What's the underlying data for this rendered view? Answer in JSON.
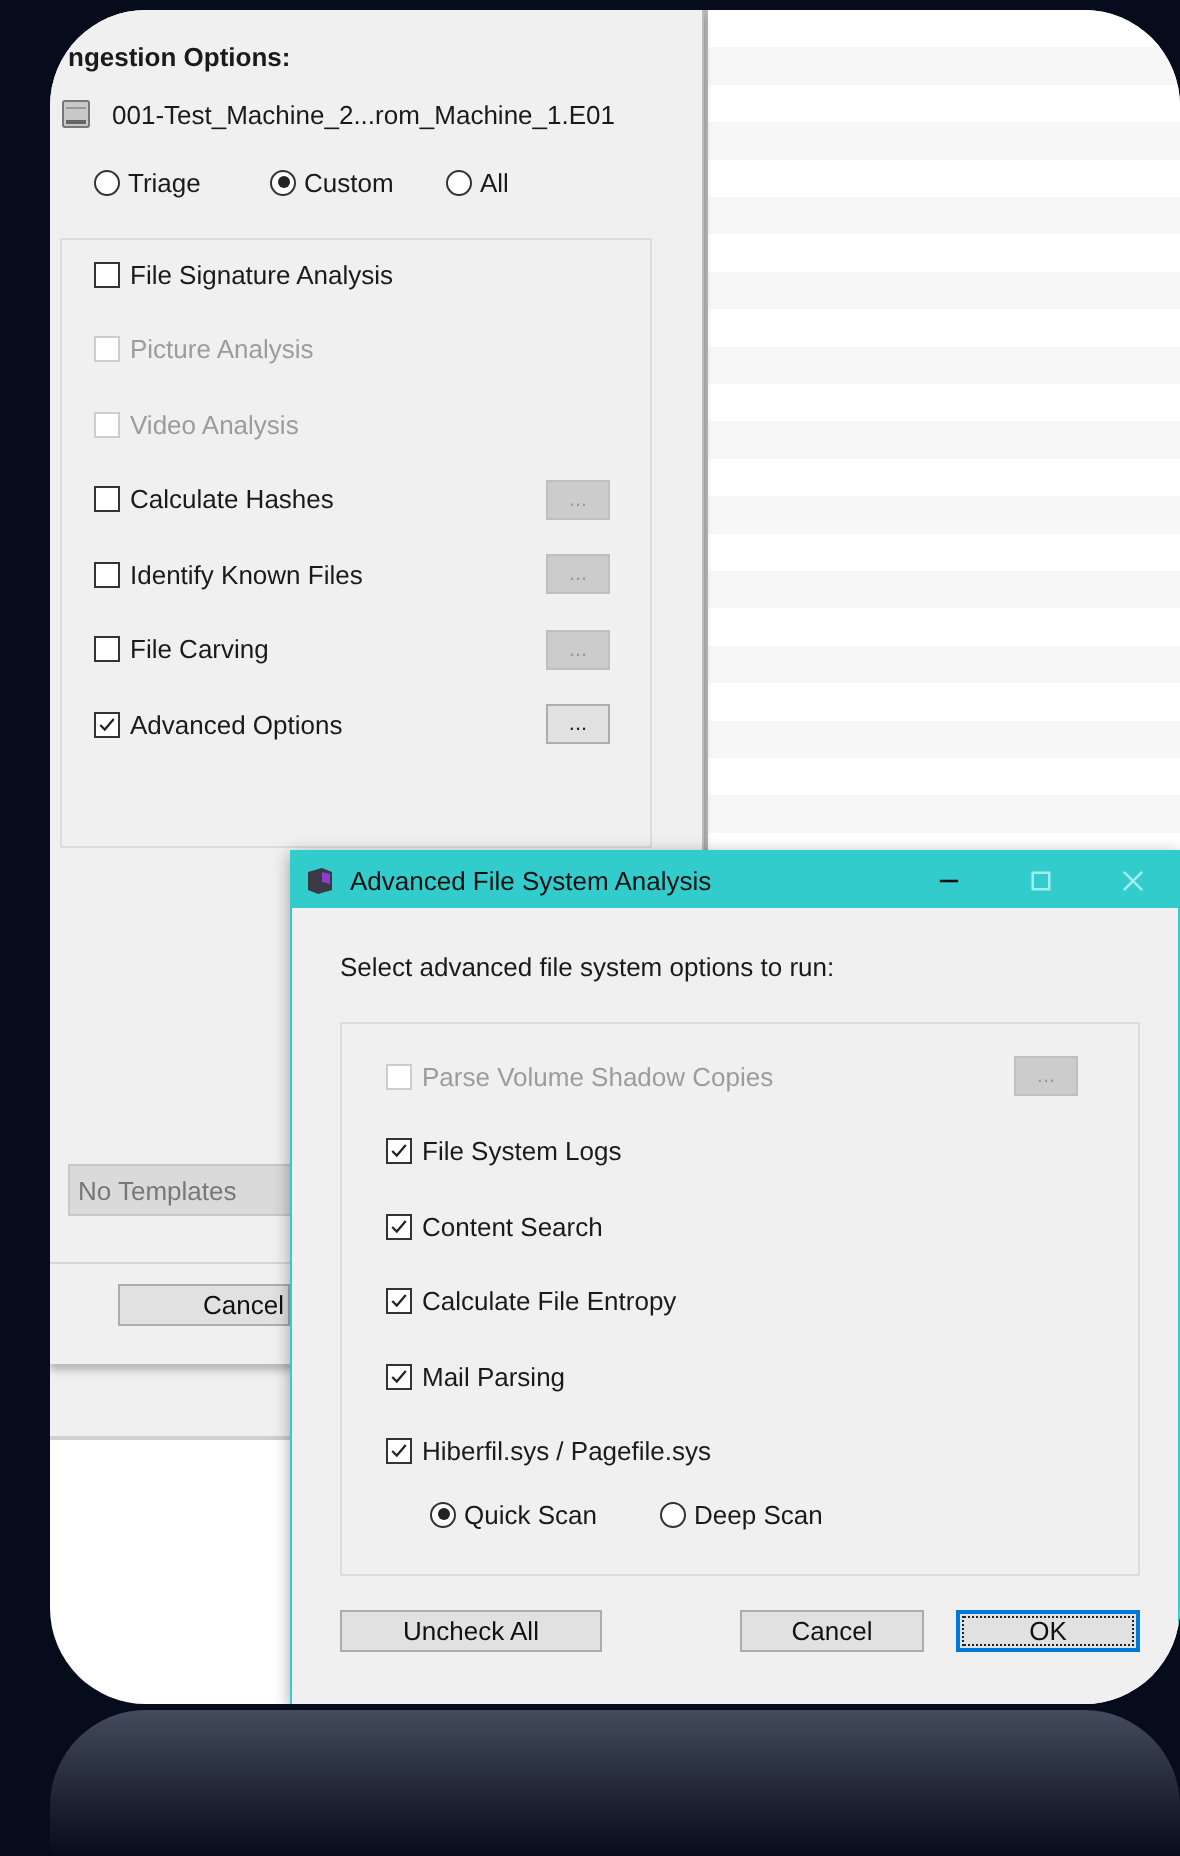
{
  "ingestion_dialog": {
    "title": "ngestion Options:",
    "source": "001-Test_Machine_2...rom_Machine_1.E01",
    "modes": [
      {
        "label": "Triage",
        "selected": false
      },
      {
        "label": "Custom",
        "selected": true
      },
      {
        "label": "All",
        "selected": false
      }
    ],
    "options": [
      {
        "label": "File Signature Analysis",
        "checked": false,
        "disabled": false
      },
      {
        "label": "Picture Analysis",
        "checked": false,
        "disabled": true
      },
      {
        "label": "Video Analysis",
        "checked": false,
        "disabled": true
      },
      {
        "label": "Calculate Hashes",
        "checked": false,
        "disabled": false,
        "settings": {
          "label": "...",
          "disabled": true
        }
      },
      {
        "label": "Identify Known Files",
        "checked": false,
        "disabled": false,
        "settings": {
          "label": "...",
          "disabled": true
        }
      },
      {
        "label": "File Carving",
        "checked": false,
        "disabled": false,
        "settings": {
          "label": "...",
          "disabled": true
        }
      },
      {
        "label": "Advanced Options",
        "checked": true,
        "disabled": false,
        "settings": {
          "label": "...",
          "disabled": false
        }
      }
    ],
    "template_field": {
      "value": "No Templates"
    },
    "cancel_button": "Cancel"
  },
  "advanced_dialog": {
    "title": "Advanced File System Analysis",
    "title_buttons": [
      {
        "kind": "minimize",
        "disabled": false
      },
      {
        "kind": "maximize",
        "disabled": true
      },
      {
        "kind": "close",
        "disabled": true
      }
    ],
    "prompt": "Select advanced file system options to run:",
    "options": [
      {
        "label": "Parse Volume Shadow Copies",
        "checked": false,
        "disabled": true,
        "settings": {
          "label": "...",
          "disabled": true
        }
      },
      {
        "label": "File System Logs",
        "checked": true,
        "disabled": false
      },
      {
        "label": "Content Search",
        "checked": true,
        "disabled": false
      },
      {
        "label": "Calculate File Entropy",
        "checked": true,
        "disabled": false
      },
      {
        "label": "Mail Parsing",
        "checked": true,
        "disabled": false
      },
      {
        "label": "Hiberfil.sys / Pagefile.sys",
        "checked": true,
        "disabled": false
      }
    ],
    "scan_modes": [
      {
        "label": "Quick Scan",
        "selected": true
      },
      {
        "label": "Deep Scan",
        "selected": false
      }
    ],
    "buttons": [
      {
        "label": "Uncheck All",
        "focused": false
      },
      {
        "label": "Cancel",
        "focused": false
      },
      {
        "label": "OK",
        "focused": true
      }
    ]
  }
}
